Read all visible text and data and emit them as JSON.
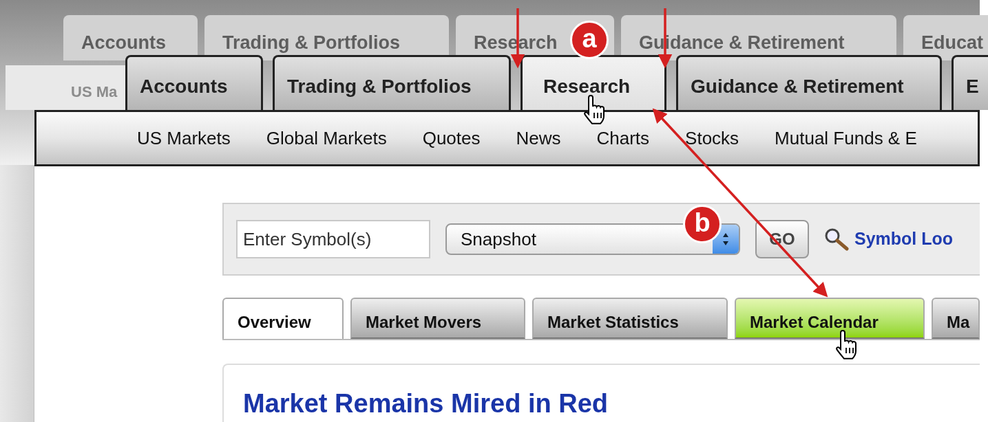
{
  "background_tabs": [
    "Accounts",
    "Trading & Portfolios",
    "Research",
    "Guidance & Retirement",
    "Educat"
  ],
  "background_subnav": "US Ma",
  "main_tabs": [
    {
      "label": "Accounts",
      "selected": false
    },
    {
      "label": "Trading & Portfolios",
      "selected": false
    },
    {
      "label": "Research",
      "selected": true
    },
    {
      "label": "Guidance & Retirement",
      "selected": false
    },
    {
      "label": "E",
      "selected": false
    }
  ],
  "subnav": [
    "US Markets",
    "Global Markets",
    "Quotes",
    "News",
    "Charts",
    "Stocks",
    "Mutual Funds & E"
  ],
  "toolbar": {
    "symbol_field": {
      "placeholder": "Enter Symbol(s)"
    },
    "view_select": {
      "value": "Snapshot"
    },
    "go_button": "GO",
    "lookup_link": "Symbol Loo"
  },
  "content_tabs": [
    {
      "label": "Overview",
      "selected": true,
      "hovered": false
    },
    {
      "label": "Market Movers",
      "selected": false,
      "hovered": false
    },
    {
      "label": "Market Statistics",
      "selected": false,
      "hovered": false
    },
    {
      "label": "Market Calendar",
      "selected": false,
      "hovered": true
    },
    {
      "label": "Ma",
      "selected": false,
      "hovered": false
    }
  ],
  "headline": "Market Remains Mired in Red",
  "annotations": [
    {
      "label": "a"
    },
    {
      "label": "b"
    }
  ]
}
